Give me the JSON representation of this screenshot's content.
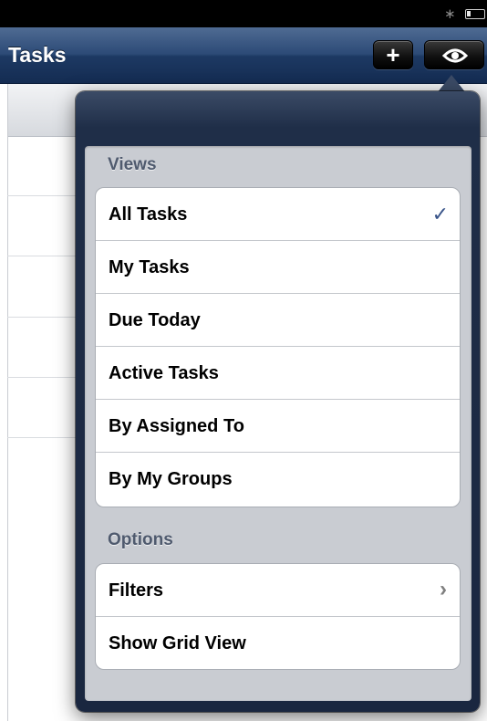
{
  "status_bar": {
    "bluetooth_icon": "bluetooth-icon",
    "battery_icon": "battery-icon"
  },
  "nav_bar": {
    "title": "Tasks",
    "add_button_icon": "plus-icon",
    "view_button_icon": "eye-icon"
  },
  "popover": {
    "views_header": "Views",
    "views": [
      {
        "label": "All Tasks",
        "selected": true
      },
      {
        "label": "My Tasks",
        "selected": false
      },
      {
        "label": "Due Today",
        "selected": false
      },
      {
        "label": "Active Tasks",
        "selected": false
      },
      {
        "label": "By Assigned To",
        "selected": false
      },
      {
        "label": "By My Groups",
        "selected": false
      }
    ],
    "options_header": "Options",
    "options": [
      {
        "label": "Filters",
        "accessory": "chevron-right-icon"
      },
      {
        "label": "Show Grid View",
        "accessory": ""
      }
    ]
  },
  "colors": {
    "nav_bar": "#1d3963",
    "checkmark": "#395489",
    "section_header": "#4f5a6e"
  }
}
